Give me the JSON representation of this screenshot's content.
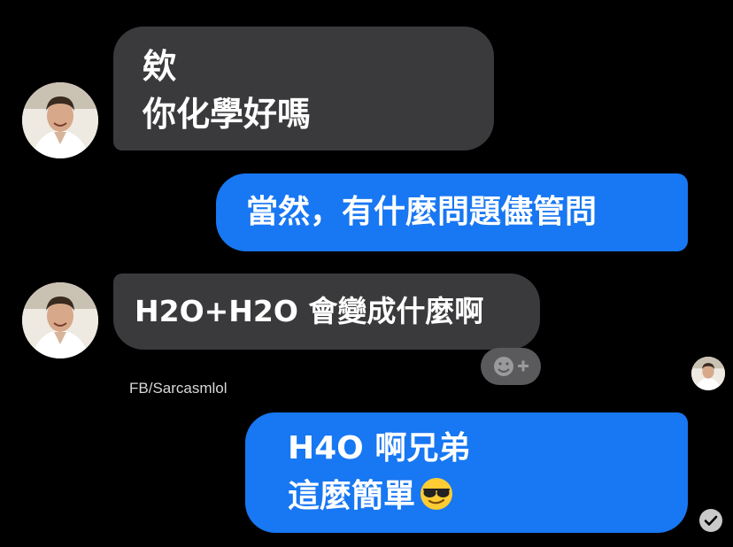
{
  "conversation": {
    "messages": [
      {
        "from": "other",
        "lines": [
          "欸",
          "你化學好嗎"
        ]
      },
      {
        "from": "me",
        "lines": [
          "當然，有什麼問題儘管問"
        ]
      },
      {
        "from": "other",
        "lines": [
          "H2O+H2O 會變成什麼啊"
        ]
      },
      {
        "from": "me",
        "lines": [
          "H4O 啊兄弟",
          "這麼簡單"
        ],
        "emoji": "smiling-face-with-sunglasses"
      }
    ]
  },
  "watermark": "FB/Sarcasmlol",
  "icons": {
    "reaction": "add-reaction-icon",
    "read_receipt": "read-check-icon",
    "avatar": "contact-avatar"
  },
  "colors": {
    "background": "#000000",
    "incoming_bubble": "#3a3a3c",
    "outgoing_bubble": "#1877f2",
    "text": "#ffffff"
  }
}
